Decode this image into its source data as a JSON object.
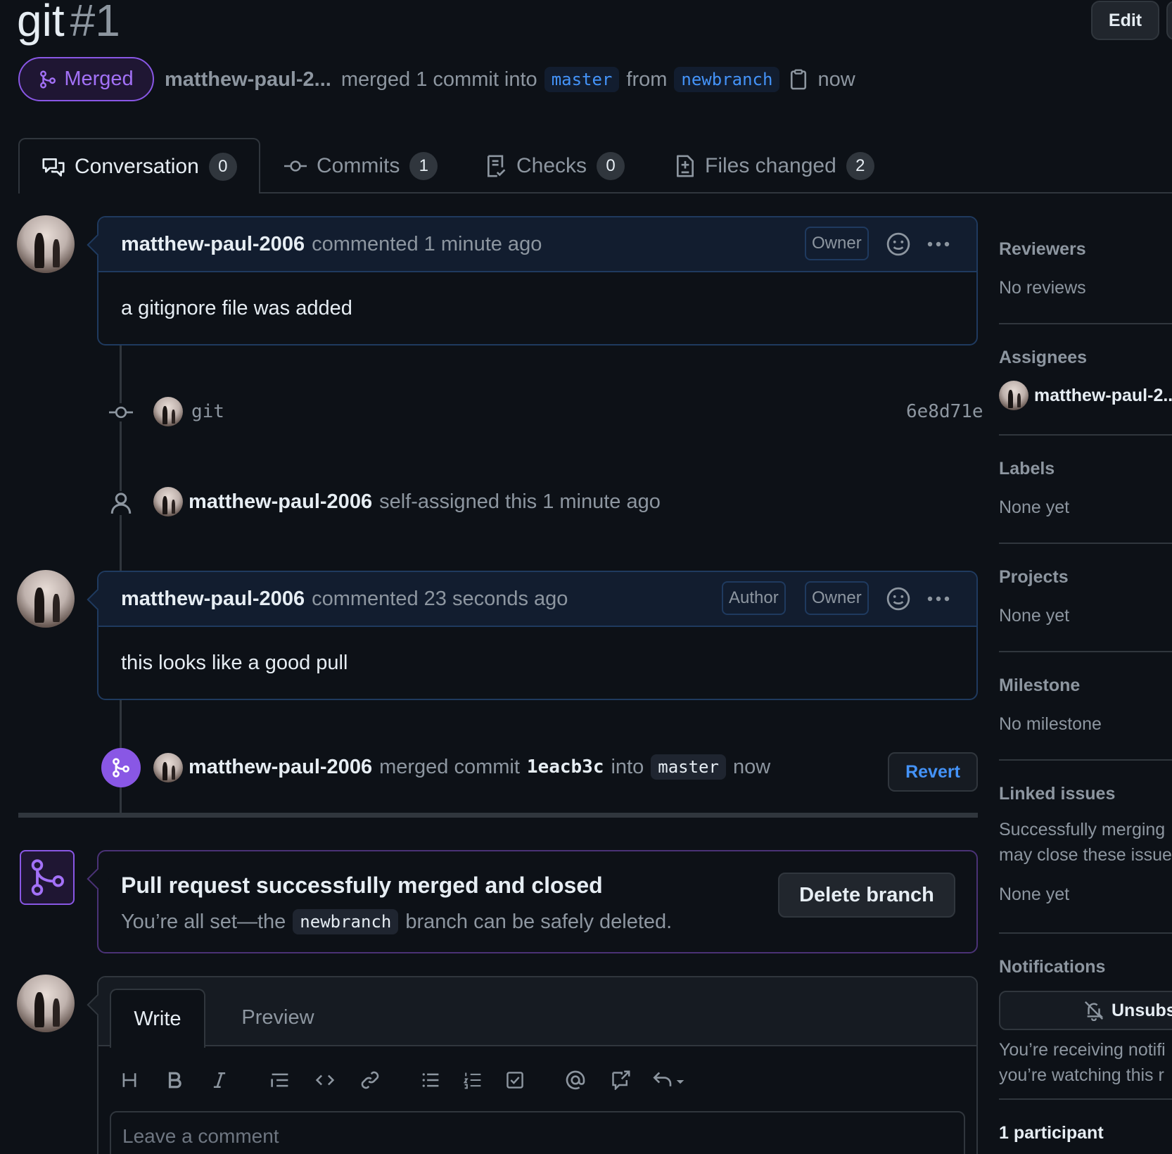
{
  "header": {
    "title": "git",
    "number": "#1",
    "edit_label": "Edit",
    "status": "Merged",
    "author": "matthew-paul-2...",
    "merged_text": "merged 1 commit into",
    "base_branch": "master",
    "from_text": "from",
    "head_branch": "newbranch",
    "time": "now"
  },
  "tabs": [
    {
      "label": "Conversation",
      "count": "0"
    },
    {
      "label": "Commits",
      "count": "1"
    },
    {
      "label": "Checks",
      "count": "0"
    },
    {
      "label": "Files changed",
      "count": "2"
    }
  ],
  "comments": [
    {
      "author": "matthew-paul-2006",
      "action": "commented 1 minute ago",
      "badges": [
        "Owner"
      ],
      "body": "a gitignore file was added"
    },
    {
      "author": "matthew-paul-2006",
      "action": "commented 23 seconds ago",
      "badges": [
        "Author",
        "Owner"
      ],
      "body": "this looks like a good pull"
    }
  ],
  "commit": {
    "message": "git",
    "sha": "6e8d71e"
  },
  "assign_event": {
    "author": "matthew-paul-2006",
    "text": "self-assigned this 1 minute ago"
  },
  "merge_event": {
    "author": "matthew-paul-2006",
    "text": "merged commit",
    "sha": "1eacb3c",
    "into": "into",
    "branch": "master",
    "time": "now",
    "revert_label": "Revert"
  },
  "merged_box": {
    "title": "Pull request successfully merged and closed",
    "sub_pre": "You’re all set—the",
    "branch": "newbranch",
    "sub_post": "branch can be safely deleted.",
    "delete_label": "Delete branch"
  },
  "composer": {
    "write_tab": "Write",
    "preview_tab": "Preview",
    "placeholder": "Leave a comment"
  },
  "sidebar": {
    "reviewers": {
      "title": "Reviewers",
      "value": "No reviews"
    },
    "assignees": {
      "title": "Assignees",
      "value": "matthew-paul-2..."
    },
    "labels": {
      "title": "Labels",
      "value": "None yet"
    },
    "projects": {
      "title": "Projects",
      "value": "None yet"
    },
    "milestone": {
      "title": "Milestone",
      "value": "No milestone"
    },
    "linked_issues": {
      "title": "Linked issues",
      "line1": "Successfully merging",
      "line2": "may close these issue",
      "value": "None yet"
    },
    "notifications": {
      "title": "Notifications",
      "button": "Unsubs",
      "line1": "You’re receiving notifi",
      "line2": "you’re watching this r"
    },
    "participants": {
      "title": "1 participant"
    }
  },
  "colors": {
    "merged_purple": "#8957e5",
    "link_blue": "#4493f8",
    "background": "#0d1117"
  }
}
